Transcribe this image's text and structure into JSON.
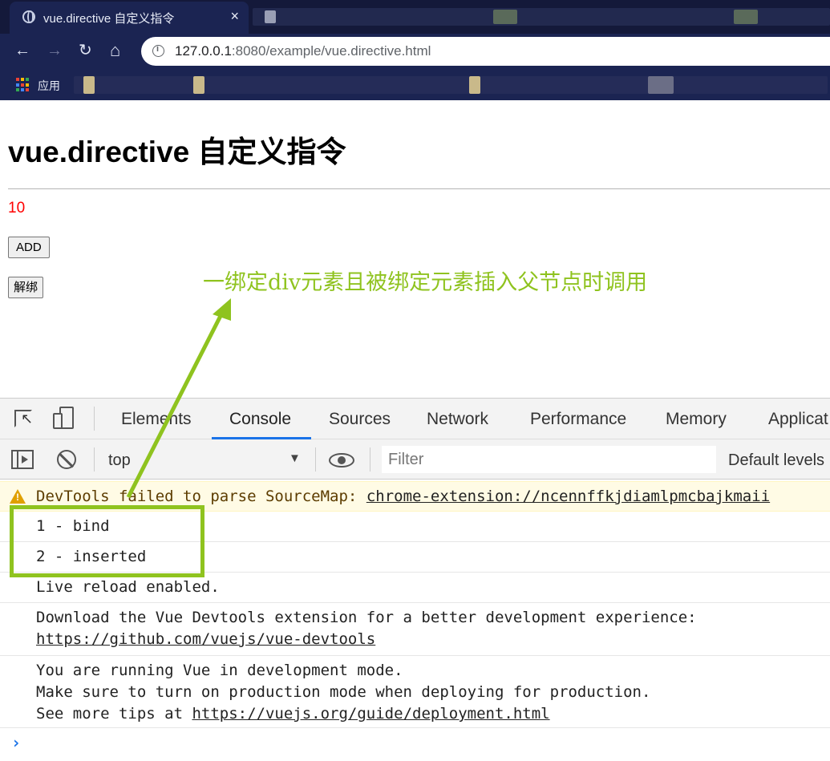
{
  "browser": {
    "tab_title": "vue.directive 自定义指令",
    "tab_close": "×",
    "url_host": "127.0.0.1",
    "url_rest": ":8080/example/vue.directive.html",
    "nav": {
      "back": "←",
      "forward": "→",
      "reload": "↻",
      "home": "⌂"
    },
    "bookmarks_apps_label": "应用"
  },
  "page": {
    "heading": "vue.directive 自定义指令",
    "count_value": "10",
    "count_color": "#ff0000",
    "add_button": "ADD",
    "unbind_button": "解绑",
    "annotation": "一绑定div元素且被绑定元素插入父节点时调用",
    "annotation_color": "#8fc31f"
  },
  "devtools": {
    "tabs": [
      "Elements",
      "Console",
      "Sources",
      "Network",
      "Performance",
      "Memory",
      "Applicat"
    ],
    "active_tab": "Console",
    "context": "top",
    "context_arrow": "▼",
    "filter_placeholder": "Filter",
    "levels": "Default levels",
    "console_messages": {
      "warning_prefix": "DevTools failed to parse SourceMap: ",
      "warning_link": "chrome-extension://ncennffkjdiamlpmcbajkmaii",
      "line_bind": "1 - bind",
      "line_inserted": "2 - inserted",
      "line_live_reload": "Live reload enabled.",
      "line_devtools": "Download the Vue Devtools extension for a better development experience:",
      "line_devtools_link": "https://github.com/vuejs/vue-devtools",
      "line_devmode_1": "You are running Vue in development mode.",
      "line_devmode_2": "Make sure to turn on production mode when deploying for production.",
      "line_devmode_3_prefix": "See more tips at ",
      "line_devmode_3_link": "https://vuejs.org/guide/deployment.html"
    },
    "prompt": "›"
  }
}
